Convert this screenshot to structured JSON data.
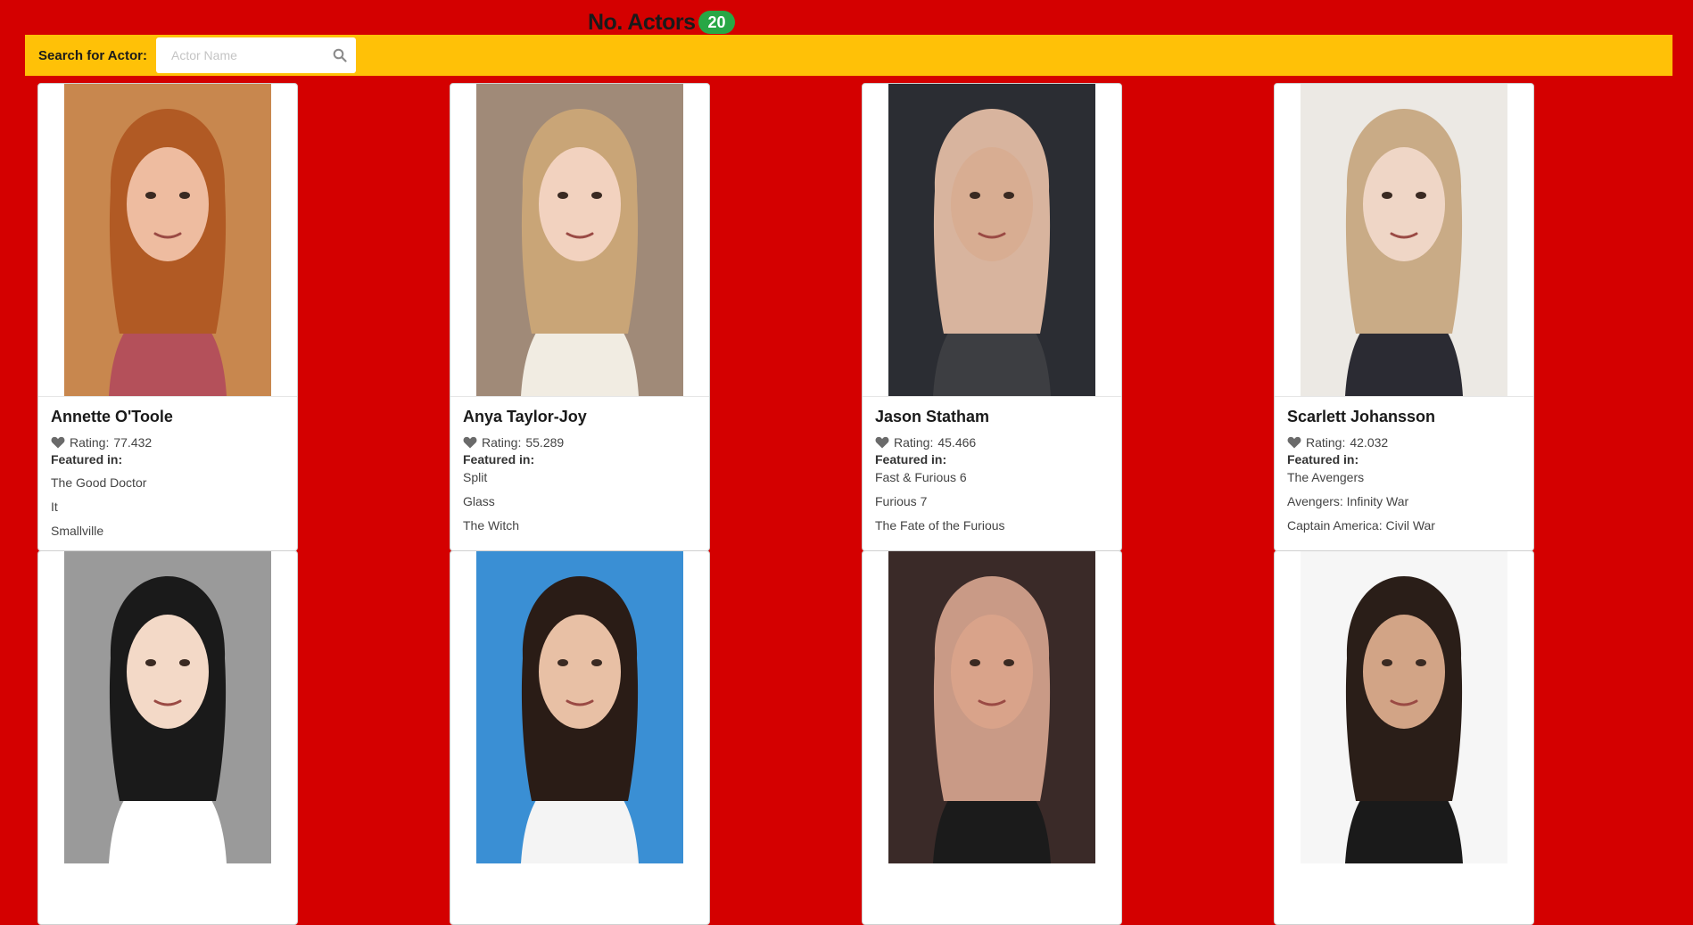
{
  "header": {
    "title": "No. Actors",
    "count": "20"
  },
  "search": {
    "label": "Search for Actor:",
    "placeholder": "Actor Name",
    "value": "",
    "icon": "search-icon"
  },
  "rating_label": "Rating:",
  "featured_label": "Featured in:",
  "actors": [
    {
      "name": "Annette O'Toole",
      "rating": "77.432",
      "films": [
        "The Good Doctor",
        "It",
        "Smallville"
      ],
      "photo": {
        "bg": "#c8874e",
        "hair": "#b15a24",
        "skin": "#eebca0",
        "shirt": "#b4505a"
      }
    },
    {
      "name": "Anya Taylor-Joy",
      "rating": "55.289",
      "films": [
        "Split",
        "Glass",
        "The Witch"
      ],
      "photo": {
        "bg": "#a08a78",
        "hair": "#c9a577",
        "skin": "#f2d2bf",
        "shirt": "#f1ece2"
      }
    },
    {
      "name": "Jason Statham",
      "rating": "45.466",
      "films": [
        "Fast & Furious 6",
        "Furious 7",
        "The Fate of the Furious"
      ],
      "photo": {
        "bg": "#2b2d33",
        "hair": "#d8b49e",
        "skin": "#d8ad92",
        "shirt": "#3d3e42"
      }
    },
    {
      "name": "Scarlett Johansson",
      "rating": "42.032",
      "films": [
        "The Avengers",
        "Avengers: Infinity War",
        "Captain America: Civil War"
      ],
      "photo": {
        "bg": "#ece9e4",
        "hair": "#c9ab86",
        "skin": "#efd6c6",
        "shirt": "#2b2b33"
      }
    },
    {
      "name": "",
      "rating": "",
      "films": [],
      "photo": {
        "bg": "#9a9a9a",
        "hair": "#1a1a1a",
        "skin": "#f3d9c7",
        "shirt": "#ffffff"
      }
    },
    {
      "name": "",
      "rating": "",
      "films": [],
      "photo": {
        "bg": "#3a8fd4",
        "hair": "#2a1c16",
        "skin": "#e8c0a5",
        "shirt": "#f4f4f4"
      }
    },
    {
      "name": "",
      "rating": "",
      "films": [],
      "photo": {
        "bg": "#3a2a28",
        "hair": "#c99a86",
        "skin": "#d9a38a",
        "shirt": "#1b1b1b"
      }
    },
    {
      "name": "",
      "rating": "",
      "films": [],
      "photo": {
        "bg": "#f6f6f6",
        "hair": "#2a1e18",
        "skin": "#d2a486",
        "shirt": "#1a1a1a"
      }
    }
  ]
}
